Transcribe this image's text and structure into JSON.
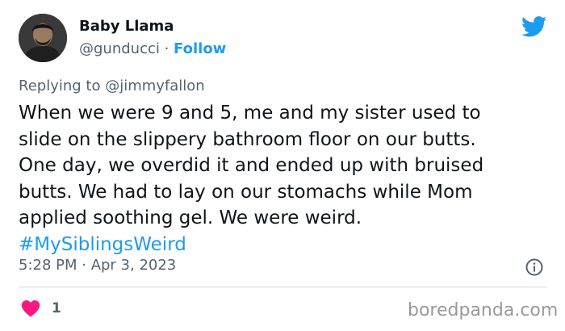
{
  "author": {
    "name": "Baby Llama",
    "handle": "@gunducci",
    "separator": " · ",
    "follow_label": "Follow"
  },
  "reply": {
    "prefix": "Replying to ",
    "to_handle": "@jimmyfallon"
  },
  "tweet": {
    "text": "When we were 9 and 5, me and my sister used to\nslide on the slippery bathroom floor on our butts.\nOne day, we overdid it and ended up with bruised\nbutts. We had to lay on our stomachs while  Mom\napplied soothing gel. We were weird.\n",
    "hashtag": "#MySiblingsWeird"
  },
  "timestamp": "5:28 PM · Apr 3, 2023",
  "likes": "1",
  "watermark": "boredpanda.com",
  "icons": {
    "platform": "twitter-bird-icon",
    "info": "info-icon",
    "like": "heart-icon"
  },
  "colors": {
    "accent": "#1d9bf0",
    "heart": "#f91880",
    "muted": "#536471"
  }
}
